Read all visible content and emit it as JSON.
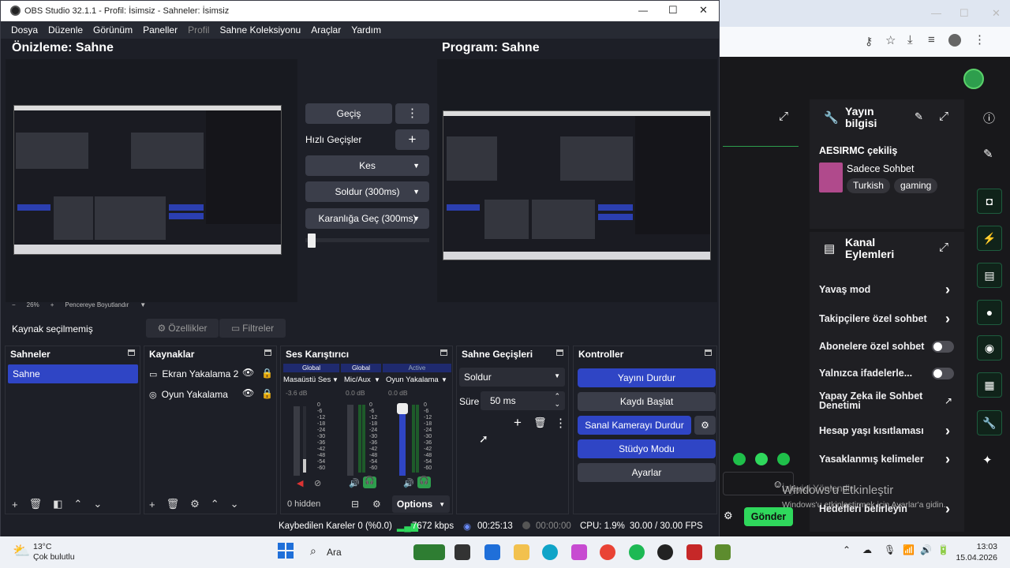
{
  "window": {
    "title": "OBS Studio 32.1.1 - Profil: İsimsiz - Sahneler: İsimsiz",
    "minimize": "—",
    "maximize": "☐",
    "close": "✕"
  },
  "menu": [
    "Dosya",
    "Düzenle",
    "Görünüm",
    "Paneller",
    "Profil",
    "Sahne Koleksiyonu",
    "Araçlar",
    "Yardım"
  ],
  "preview": {
    "label": "Önizleme: Sahne",
    "zoom": "26%",
    "zoom_minus": "−",
    "zoom_plus": "+",
    "fit": "Pencereye Boyutlandır"
  },
  "program": {
    "label": "Program: Sahne"
  },
  "transitions_center": {
    "transition": "Geçiş",
    "quick": "Hızlı Geçişler",
    "items": [
      "Kes",
      "Soldur (300ms)",
      "Karanlığa Geç (300ms)"
    ],
    "progress": 0.02
  },
  "source_toolbar": {
    "no_selection": "Kaynak seçilmemiş",
    "properties": "Özellikler",
    "filters": "Filtreler"
  },
  "scenes": {
    "title": "Sahneler",
    "items": [
      "Sahne"
    ]
  },
  "sources": {
    "title": "Kaynaklar",
    "items": [
      {
        "name": "Ekran Yakalama 2",
        "icon": "monitor-icon"
      },
      {
        "name": "Oyun Yakalama",
        "icon": "gamepad-icon"
      }
    ]
  },
  "mixer": {
    "title": "Ses Karıştırıcı",
    "channels": [
      {
        "tag": "Global",
        "name": "Masaüstü Ses",
        "db": "-3.6 dB",
        "muted": true,
        "level": 0.2
      },
      {
        "tag": "Global",
        "name": "Mic/Aux",
        "db": "0.0 dB",
        "muted": false,
        "level": 0.0
      },
      {
        "tag": "Active",
        "name": "Oyun Yakalama",
        "db": "0.0 dB",
        "muted": false,
        "level": 0.0
      }
    ],
    "scale": [
      "0",
      "-6",
      "-12",
      "-18",
      "-24",
      "-30",
      "-36",
      "-42",
      "-48",
      "-54",
      "-60"
    ],
    "hidden": "0 hidden",
    "options": "Options"
  },
  "scene_transitions": {
    "title": "Sahne Geçişleri",
    "selected": "Soldur",
    "duration_label": "Süre",
    "duration": "50 ms"
  },
  "controls": {
    "title": "Kontroller",
    "stop_stream": "Yayını Durdur",
    "start_record": "Kaydı Başlat",
    "stop_vcam": "Sanal Kamerayı Durdur",
    "studio": "Stüdyo Modu",
    "settings": "Ayarlar"
  },
  "status": {
    "dropped": "Kaybedilen Kareler 0 (%0.0)",
    "bitrate": "7672 kbps",
    "stream_time": "00:25:13",
    "rec_time": "00:00:00",
    "cpu": "CPU: 1.9%",
    "fps": "30.00 / 30.00 FPS"
  },
  "twitch": {
    "stream_info_title": "Yayın bilgisi",
    "channel": "AESIRMC çekiliş",
    "category": "Sadece Sohbet",
    "tags": [
      "Turkish",
      "gaming"
    ],
    "actions_title": "Kanal Eylemleri",
    "actions": [
      {
        "label": "Yavaş mod",
        "kind": "chevron"
      },
      {
        "label": "Takipçilere özel sohbet",
        "kind": "chevron"
      },
      {
        "label": "Abonelere özel sohbet",
        "kind": "toggle"
      },
      {
        "label": "Yalnızca ifadelerle...",
        "kind": "toggle"
      },
      {
        "label": "Yapay Zeka ile Sohbet Denetimi",
        "kind": "external"
      },
      {
        "label": "Hesap yaşı kısıtlaması",
        "kind": "chevron"
      },
      {
        "label": "Yasaklanmış kelimeler",
        "kind": "chevron"
      },
      {
        "label": "Hedefleri belirleyin",
        "kind": "chevron"
      }
    ],
    "send": "Gönder",
    "watermark_1": "Windows'u Etkinleştir",
    "watermark_2": "Windows'u etkinleştirmek için Ayarlar'a gidin.",
    "ghost_text": "İzleyici Yönlendir"
  },
  "taskbar": {
    "temp": "13°C",
    "weather": "Çok bulutlu",
    "search": "Ara",
    "time": "13:03",
    "date": "15.04.2026"
  }
}
